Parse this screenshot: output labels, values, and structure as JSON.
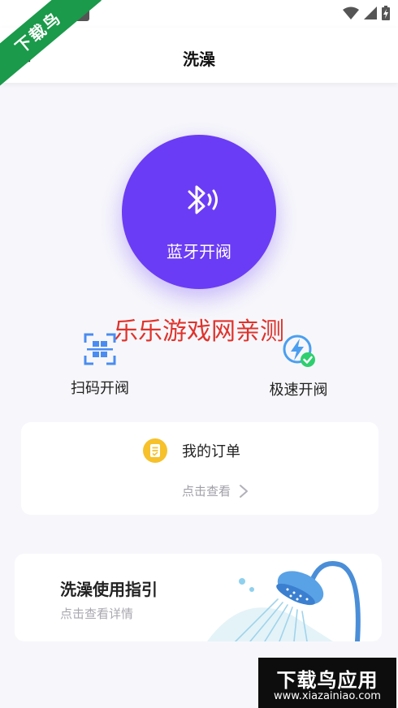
{
  "corner_badge": "下载鸟",
  "header": {
    "title": "洗澡"
  },
  "bluetooth_button": {
    "label": "蓝牙开阀",
    "icon": "bluetooth-signal-icon",
    "color": "#6b3cf5"
  },
  "watermark": "乐乐游戏网亲测",
  "quick_actions": [
    {
      "label": "扫码开阀",
      "icon": "qr-scan-icon"
    },
    {
      "label": "极速开阀",
      "icon": "lightning-check-icon"
    }
  ],
  "orders": {
    "title": "我的订单",
    "link": "点击查看",
    "icon": "order-note-icon"
  },
  "guide": {
    "title": "洗澡使用指引",
    "subtitle": "点击查看详情",
    "illustration": "shower-head-illustration"
  },
  "brand": {
    "title": "下载鸟应用",
    "url": "www.xiazainiao.com"
  }
}
